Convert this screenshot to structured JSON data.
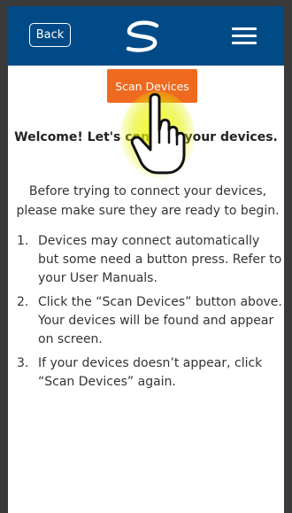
{
  "header": {
    "back_label": "Back",
    "logo_icon": "s-swoosh-logo",
    "menu_icon": "hamburger-menu-icon",
    "background_color": "#004b87"
  },
  "scan_button": {
    "label": "Scan Devices",
    "color": "#ef6a1f"
  },
  "welcome": {
    "visible_text": "Welcome! Let's connect your devices."
  },
  "intro": "Before trying to connect your devices, please make sure they are ready to begin.",
  "steps": [
    {
      "number": "1.",
      "text": "Devices may connect automatically but some need a button press. Refer to your User Manuals."
    },
    {
      "number": "2.",
      "text": "Click the “Scan Devices” button above. Your devices will be found and appear on screen."
    },
    {
      "number": "3.",
      "text": "If your devices doesn’t appear, click “Scan Devices” again."
    }
  ],
  "overlay": {
    "pointer_icon": "hand-pointer-icon",
    "highlight_color": "#e6f000"
  }
}
